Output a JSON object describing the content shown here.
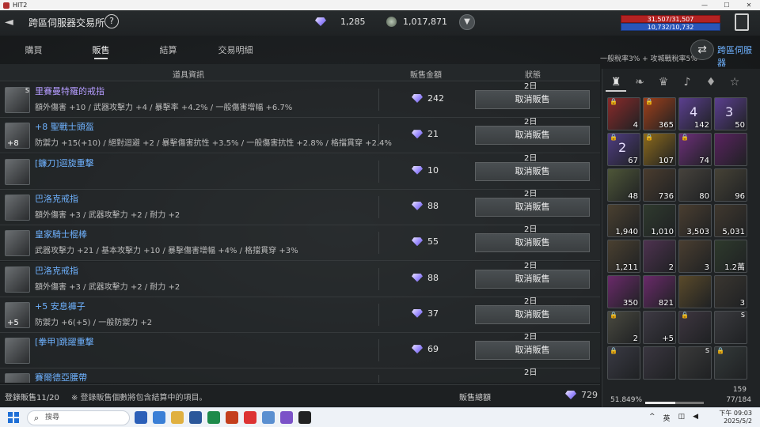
{
  "window": {
    "title": "HIT2"
  },
  "header": {
    "title": "跨區伺服器交易所",
    "help": "?",
    "diamonds": "1,285",
    "coins": "1,017,871",
    "hp": "31,507/31,507",
    "mp": "10,732/10,732"
  },
  "tabs": [
    "購買",
    "販售",
    "結算",
    "交易明細"
  ],
  "active_tab": "販售",
  "tax_text": "一般稅率3% + 攻城戰稅率5%",
  "server_link": "跨區伺服器",
  "table": {
    "headers": {
      "info": "道具資訊",
      "price": "販售金額",
      "status": "狀態"
    },
    "rows": [
      {
        "name": "里賽曼特羅的戒指",
        "stats": "額外傷害 +10 / 武器攻擊力 +4 / 暴擊率 +4.2% / 一般傷害增幅 +6.7%",
        "price": "242",
        "days": "2日",
        "action": "取消販售",
        "icon_plus": "",
        "icon_lock": "S",
        "name_color": "purple"
      },
      {
        "name": "+8 聖戰士頭盔",
        "stats": "防禦力 +15(+10) / 絕對迴避 +2 / 暴擊傷害抗性 +3.5% / 一般傷害抗性 +2.8% / 格擋貫穿 +2.4%",
        "price": "21",
        "days": "2日",
        "action": "取消販售",
        "icon_plus": "+8",
        "icon_lock": "",
        "name_color": "blue"
      },
      {
        "name": "[鐮刀]迴旋重擊",
        "stats": "",
        "price": "10",
        "days": "2日",
        "action": "取消販售",
        "icon_plus": "",
        "icon_lock": "",
        "name_color": "blue"
      },
      {
        "name": "巴洛克戒指",
        "stats": "額外傷害 +3 / 武器攻擊力 +2 / 耐力 +2",
        "price": "88",
        "days": "2日",
        "action": "取消販售",
        "icon_plus": "",
        "icon_lock": "",
        "name_color": "blue"
      },
      {
        "name": "皇家騎士棍棒",
        "stats": "武器攻擊力 +21 / 基本攻擊力 +10 / 暴擊傷害增幅 +4% / 格擋貫穿 +3%",
        "price": "55",
        "days": "2日",
        "action": "取消販售",
        "icon_plus": "",
        "icon_lock": "",
        "name_color": "blue"
      },
      {
        "name": "巴洛克戒指",
        "stats": "額外傷害 +3 / 武器攻擊力 +2 / 耐力 +2",
        "price": "88",
        "days": "2日",
        "action": "取消販售",
        "icon_plus": "",
        "icon_lock": "",
        "name_color": "blue"
      },
      {
        "name": "+5 安息褲子",
        "stats": "防禦力 +6(+5) / 一般防禦力 +2",
        "price": "37",
        "days": "2日",
        "action": "取消販售",
        "icon_plus": "+5",
        "icon_lock": "",
        "name_color": "blue"
      },
      {
        "name": "[拳甲]跳躍重擊",
        "stats": "",
        "price": "69",
        "days": "2日",
        "action": "取消販售",
        "icon_plus": "",
        "icon_lock": "",
        "name_color": "blue"
      },
      {
        "name": "賽爾德亞腰帶",
        "stats": "",
        "price": "",
        "days": "2日",
        "action": "",
        "icon_plus": "",
        "icon_lock": "",
        "name_color": "blue"
      }
    ]
  },
  "footer": {
    "registered": "登錄販售11/20",
    "note": "※ 登錄販售個數將包含結算中的項目。",
    "total_label": "販售總額",
    "total_value": "729"
  },
  "inventory": {
    "tab_icons": [
      "bag-icon",
      "leaf-icon",
      "crown-icon",
      "horn-icon",
      "gem-icon",
      "star-icon"
    ],
    "tab_glyphs": [
      "♜",
      "❧",
      "♛",
      "♪",
      "♦",
      "☆"
    ],
    "slots": [
      {
        "count": "4",
        "color": "#8a2a2a",
        "mark": "lock"
      },
      {
        "count": "365",
        "color": "#a0401a",
        "mark": "lock"
      },
      {
        "count": "142",
        "color": "#5b3f8f",
        "mark": "",
        "glyph": "4"
      },
      {
        "count": "50",
        "color": "#5b3f8f",
        "mark": "",
        "glyph": "3"
      },
      {
        "count": "67",
        "color": "#4f3d82",
        "mark": "lock",
        "glyph": "2"
      },
      {
        "count": "107",
        "color": "#8c6a1c",
        "mark": "lock"
      },
      {
        "count": "74",
        "color": "#6d2f7a",
        "mark": "lock"
      },
      {
        "count": "",
        "color": "#5a2260",
        "mark": ""
      },
      {
        "count": "48",
        "color": "#4e5638",
        "mark": ""
      },
      {
        "count": "736",
        "color": "#4a3c2e",
        "mark": ""
      },
      {
        "count": "80",
        "color": "#46423c",
        "mark": ""
      },
      {
        "count": "96",
        "color": "#464236",
        "mark": ""
      },
      {
        "count": "1,940",
        "color": "#4a4030",
        "mark": ""
      },
      {
        "count": "1,010",
        "color": "#2f3a2e",
        "mark": ""
      },
      {
        "count": "3,503",
        "color": "#4a3e30",
        "mark": ""
      },
      {
        "count": "5,031",
        "color": "#40382e",
        "mark": ""
      },
      {
        "count": "1,211",
        "color": "#4a4030",
        "mark": ""
      },
      {
        "count": "2",
        "color": "#4e3250",
        "mark": ""
      },
      {
        "count": "3",
        "color": "#4a3e30",
        "mark": ""
      },
      {
        "count": "1.2萬",
        "color": "#2e3a2c",
        "mark": ""
      },
      {
        "count": "350",
        "color": "#6a2a6a",
        "mark": ""
      },
      {
        "count": "821",
        "color": "#6a2a6a",
        "mark": ""
      },
      {
        "count": "",
        "color": "#5a4a2a",
        "mark": ""
      },
      {
        "count": "3",
        "color": "#3a3630",
        "mark": ""
      },
      {
        "count": "2",
        "color": "#4a4a40",
        "mark": "lock"
      },
      {
        "count": "+5",
        "color": "#3e3a44",
        "mark": ""
      },
      {
        "count": "",
        "color": "#3e3640",
        "mark": "lock"
      },
      {
        "count": "",
        "color": "#3a3a3e",
        "mark": "S"
      },
      {
        "count": "",
        "color": "#3a3a44",
        "mark": "lock"
      },
      {
        "count": "",
        "color": "#3a3640",
        "mark": ""
      },
      {
        "count": "",
        "color": "#3a3a3a",
        "mark": "S"
      },
      {
        "count": "",
        "color": "#343a3a",
        "mark": "lock"
      }
    ],
    "ammo": "159",
    "weight": "51.849%",
    "weight_fraction": 0.518,
    "slots_used": "77/184"
  },
  "taskbar": {
    "search_placeholder": "搜尋",
    "ime": "英",
    "time": "下午 09:03",
    "date": "2025/5/2"
  },
  "colors": {
    "accent_blue": "#6fb2ff",
    "hp_red": "#b32222",
    "mp_blue": "#2a55b8"
  }
}
